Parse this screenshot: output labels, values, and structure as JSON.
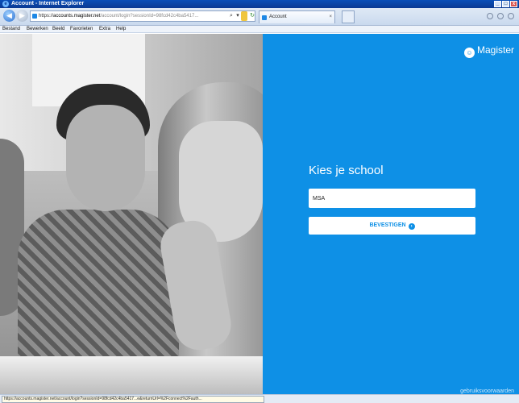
{
  "window": {
    "title": "Account - Internet Explorer",
    "controls": [
      "_",
      "□",
      "x"
    ]
  },
  "addressbar": {
    "url_prefix": "https://",
    "url_domain": "accounts.magister.net",
    "url_rest": "/account/login?sessionId=98fcd42c4ba5417...",
    "tab_title": "Account",
    "tab_close": "×"
  },
  "menu": [
    "Bestand",
    "Bewerken",
    "Beeld",
    "Favorieten",
    "Extra",
    "Help"
  ],
  "panel": {
    "brand": "Magister",
    "heading": "Kies je school",
    "school_value": "MSA",
    "confirm_label": "BEVESTIGEN",
    "terms_link": "gebruiksvoorwaarden",
    "background": "#0e90e6"
  },
  "statusbar": {
    "url": "https://accounts.magister.net/account/login?sessionId=98fcd42c4ba5417...e&returnUrl=%2Fconnect%2Fauth..."
  }
}
